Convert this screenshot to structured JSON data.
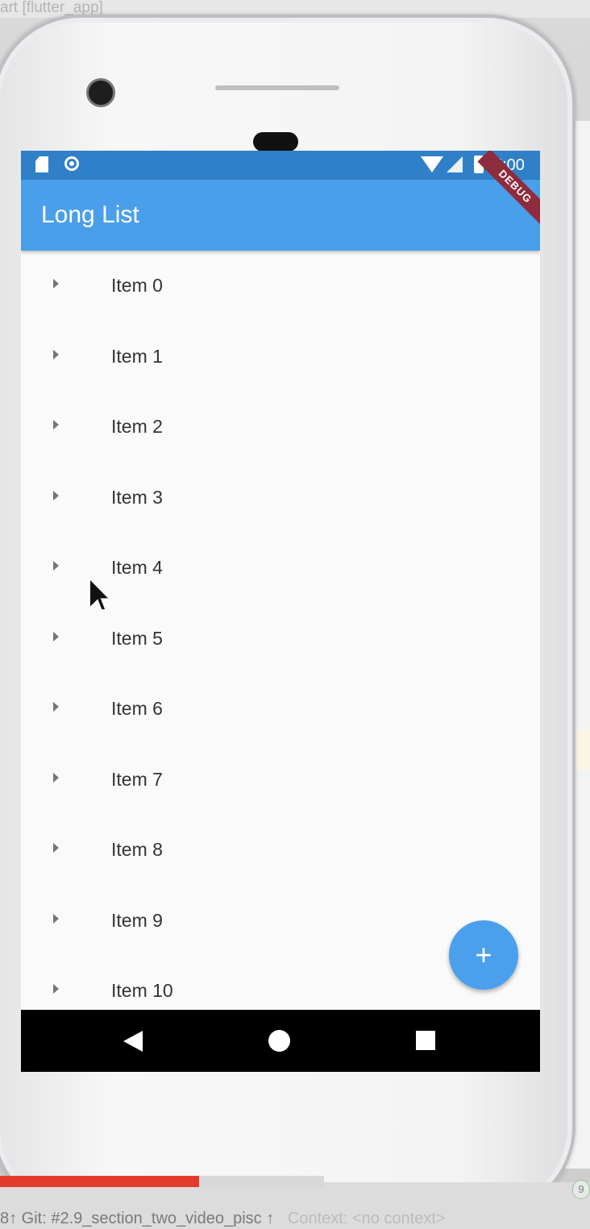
{
  "ide": {
    "window_title": "art [flutter_app]",
    "status_text": "8↑  Git: #2.9_section_two_video_pisc ↑",
    "status_context": "Context: <no context>",
    "badge": "9"
  },
  "video": {
    "progress_fraction": 0.337,
    "buffered_fraction": 0.549
  },
  "device": {
    "status_bar": {
      "time": "5:00",
      "icons": [
        "sd-card-icon",
        "circle-icon",
        "wifi-icon",
        "signal-icon",
        "battery-icon"
      ]
    },
    "debug_banner": "DEBUG",
    "app_bar": {
      "title": "Long List"
    },
    "list": {
      "items": [
        {
          "label": "Item 0"
        },
        {
          "label": "Item 1"
        },
        {
          "label": "Item 2"
        },
        {
          "label": "Item 3"
        },
        {
          "label": "Item 4"
        },
        {
          "label": "Item 5"
        },
        {
          "label": "Item 6"
        },
        {
          "label": "Item 7"
        },
        {
          "label": "Item 8"
        },
        {
          "label": "Item 9"
        },
        {
          "label": "Item 10"
        }
      ]
    },
    "fab": {
      "label": "+"
    },
    "nav_bar": {
      "icons": [
        "back-icon",
        "home-icon",
        "recents-icon"
      ]
    }
  },
  "colors": {
    "status_bar": "#2f80c8",
    "app_bar": "#4a9fea",
    "fab": "#4aa0ec",
    "progress": "#e43a2d"
  }
}
